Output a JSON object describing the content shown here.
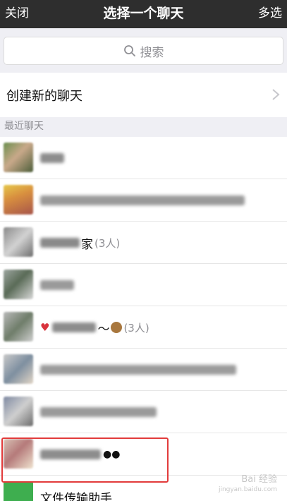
{
  "nav": {
    "close_label": "关闭",
    "title": "选择一个聊天",
    "multi_select_label": "多选"
  },
  "search": {
    "placeholder": "搜索"
  },
  "new_chat": {
    "label": "创建新的聊天"
  },
  "recent": {
    "header": "最近聊天",
    "items": [
      {
        "name_suffix": "",
        "count": "",
        "obscured": true
      },
      {
        "name_suffix": "",
        "count": "",
        "obscured": true
      },
      {
        "name_suffix": "家",
        "count": "(3人)",
        "obscured": true
      },
      {
        "name_suffix": "",
        "count": "",
        "obscured": true
      },
      {
        "name_suffix": "～",
        "count": "(3人)",
        "obscured": true
      },
      {
        "name_suffix": "",
        "count": "",
        "obscured": true
      },
      {
        "name_suffix": "",
        "count": "",
        "obscured": true
      },
      {
        "name_suffix": "",
        "count": "",
        "obscured": true,
        "highlighted": true
      },
      {
        "name_suffix": "文件传输助手",
        "count": "",
        "obscured": false
      }
    ]
  },
  "watermark": {
    "text": "Bai 经验",
    "subtext": "jingyan.baidu.com"
  },
  "colors": {
    "navbar": "#2e2e2e",
    "background": "#efeff4",
    "highlight_border": "#e23b3b",
    "secondary_text": "#8e8e93",
    "file_helper_green": "#3eae4f"
  }
}
